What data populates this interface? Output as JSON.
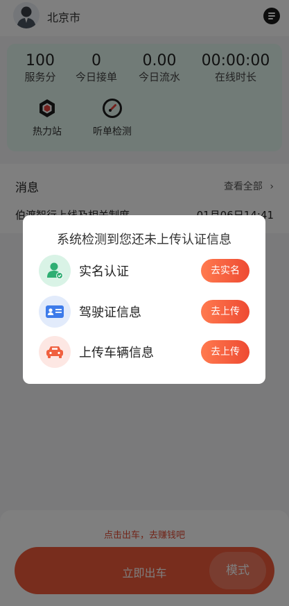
{
  "header": {
    "city": "北京市",
    "avatar_icon": "driver-avatar-icon",
    "message_icon": "message-list-icon"
  },
  "stats": [
    {
      "value": "100",
      "label": "服务分"
    },
    {
      "value": "0",
      "label": "今日接单"
    },
    {
      "value": "0.00",
      "label": "今日流水"
    },
    {
      "value": "00:00:00",
      "label": "在线时长"
    }
  ],
  "tools": [
    {
      "label": "热力站",
      "icon": "heat-station-icon"
    },
    {
      "label": "听单检测",
      "icon": "order-check-gauge-icon"
    }
  ],
  "messages": {
    "title": "消息",
    "view_all": "查看全部",
    "item_text": "伯渡智行上线及相关制度",
    "item_time": "01月06日14:41"
  },
  "bottom": {
    "hint": "点击出车，去赚钱吧",
    "go_label": "立即出车",
    "mode_label": "模式"
  },
  "modal": {
    "title": "系统检测到您还未上传认证信息",
    "rows": [
      {
        "label": "实名认证",
        "action": "去实名",
        "icon": "real-name-verified-icon"
      },
      {
        "label": "驾驶证信息",
        "action": "去上传",
        "icon": "driver-license-icon"
      },
      {
        "label": "上传车辆信息",
        "action": "去上传",
        "icon": "car-icon"
      }
    ]
  },
  "colors": {
    "accent": "#f05a3b",
    "stats_card_bg": "#e3f6ef",
    "button_gradient_start": "#ff7a4f",
    "button_gradient_end": "#ee4a32"
  }
}
